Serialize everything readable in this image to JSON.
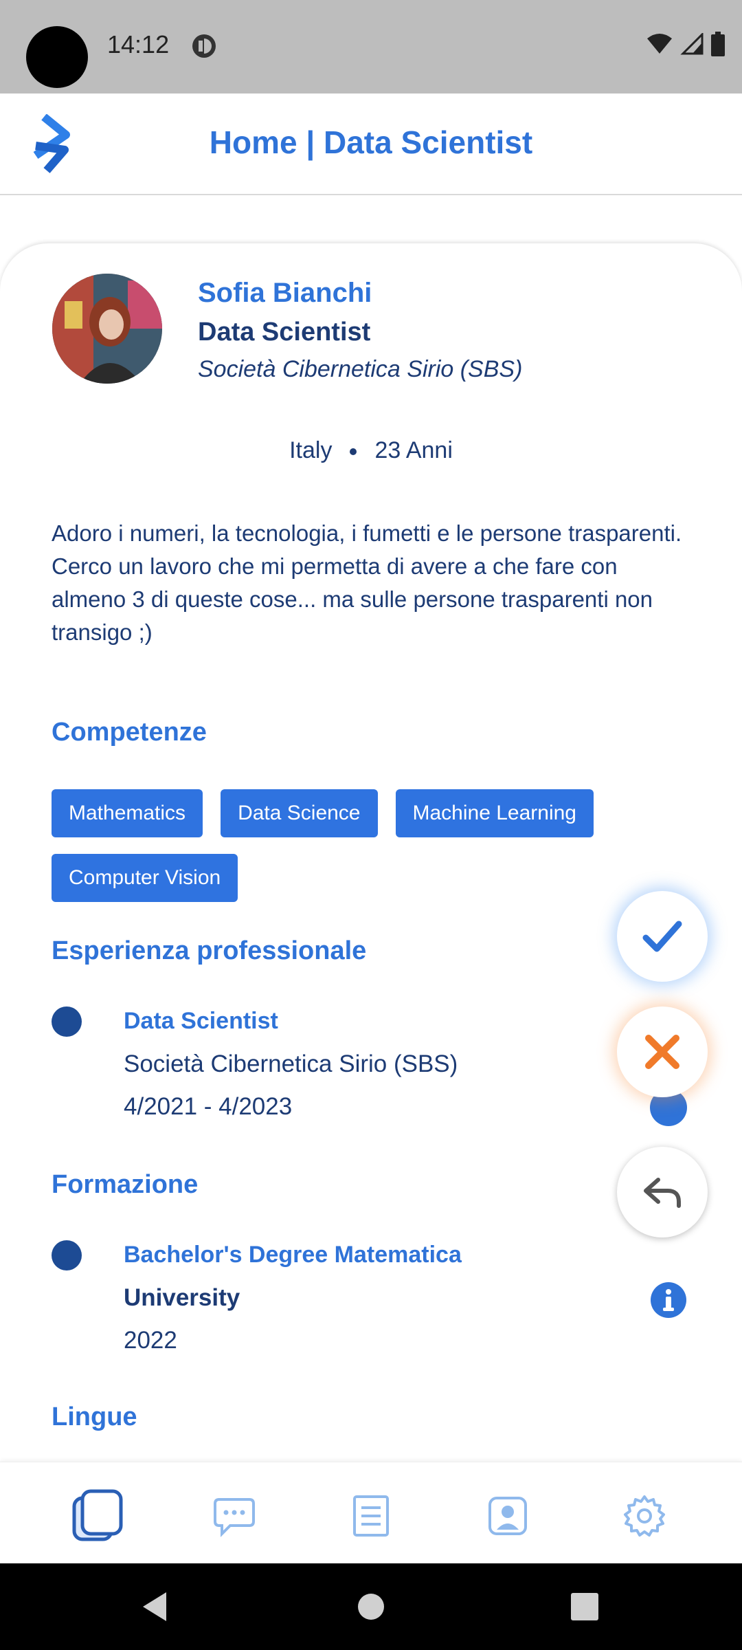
{
  "status_bar": {
    "time": "14:12"
  },
  "header": {
    "title": "Home | Data Scientist"
  },
  "profile": {
    "name": "Sofia Bianchi",
    "job_title": "Data Scientist",
    "company": "Società Cibernetica Sirio (SBS)",
    "country": "Italy",
    "age": "23 Anni",
    "bio": "Adoro i numeri, la tecnologia, i fumetti e le persone trasparenti.\nCerco un lavoro che mi permetta di avere a che fare con almeno 3 di queste cose... ma sulle persone trasparenti non transigo ;)"
  },
  "sections": {
    "skills_title": "Competenze",
    "experience_title": "Esperienza professionale",
    "education_title": "Formazione",
    "languages_title": "Lingue"
  },
  "skills": [
    "Mathematics",
    "Data Science",
    "Machine Learning",
    "Computer Vision"
  ],
  "experience": [
    {
      "role": "Data Scientist",
      "company": "Società Cibernetica Sirio (SBS)",
      "period": "4/2021 - 4/2023"
    }
  ],
  "education": [
    {
      "degree": "Bachelor's Degree Matematica",
      "institution": "University",
      "year": "2022"
    }
  ],
  "colors": {
    "accent": "#2f73d8",
    "dark_text": "#1d3b74",
    "reject": "#f07a2a",
    "chip": "#2f73e0"
  },
  "icons": {
    "fab_accept": "check-icon",
    "fab_reject": "close-icon",
    "fab_back": "reply-arrow-icon",
    "nav": [
      "cards-icon",
      "chat-icon",
      "document-icon",
      "profile-icon",
      "gear-icon"
    ]
  }
}
